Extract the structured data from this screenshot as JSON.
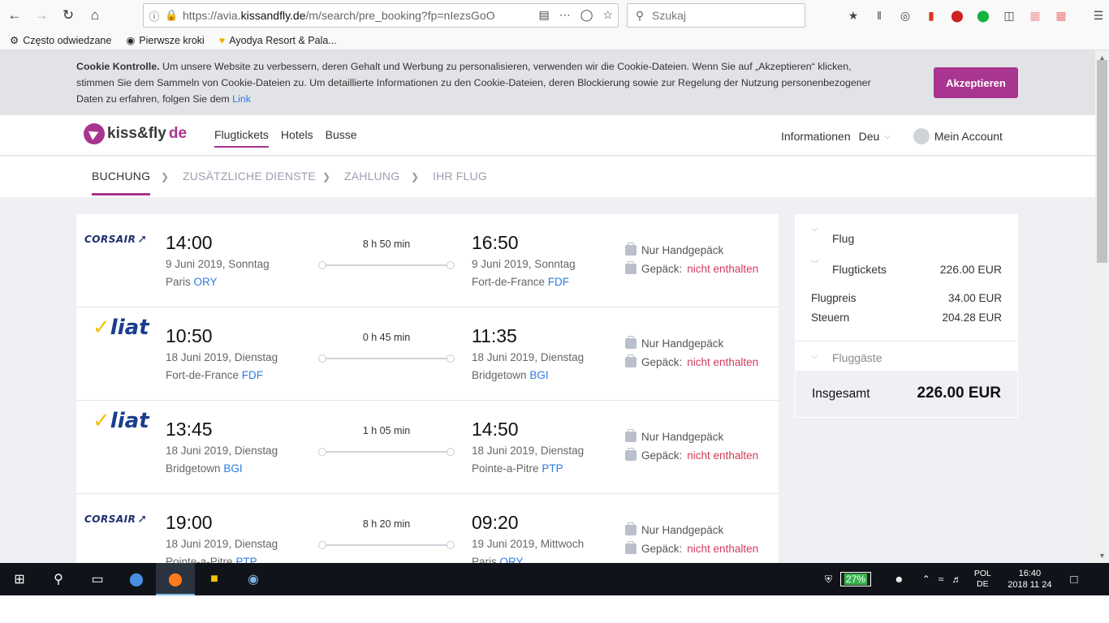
{
  "browser": {
    "url_prefix": "https://avia.",
    "url_domain": "kissandfly.de",
    "url_suffix": "/m/search/pre_booking?fp=nIezsGoO",
    "search_placeholder": "Szukaj",
    "bookmarks": [
      {
        "icon": "gear-icon",
        "label": "Często odwiedzane"
      },
      {
        "icon": "globe-icon",
        "label": "Pierwsze kroki"
      },
      {
        "icon": "heart-icon",
        "label": "Ayodya Resort & Pala..."
      }
    ]
  },
  "cookie": {
    "title": "Cookie Kontrolle.",
    "text": " Um unsere Website zu verbessern, deren Gehalt und Werbung zu personalisieren, verwenden wir die Cookie-Dateien. Wenn Sie auf „Akzeptieren“ klicken, stimmen Sie dem Sammeln von Cookie-Dateien zu. Um detaillierte Informationen zu den Cookie-Dateien, deren Blockierung sowie zur Regelung der Nutzung personenbezogener Daten zu erfahren, folgen Sie dem ",
    "link": "Link",
    "accept": "Akzeptieren"
  },
  "header": {
    "logo_main": "kiss&fly",
    "logo_accent": "de",
    "nav": [
      "Flugtickets",
      "Hotels",
      "Busse"
    ],
    "info": "Informationen",
    "lang": "Deu",
    "account": "Mein Account"
  },
  "steps": [
    "BUCHUNG",
    "ZUSÄTZLICHE DIENSTE",
    "ZAHLUNG",
    "IHR FLUG"
  ],
  "flights": [
    {
      "airline": "CORSAIR",
      "dep_time": "14:00",
      "dep_date": "9 Juni 2019, Sonntag",
      "dep_city": "Paris",
      "dep_code": "ORY",
      "duration": "8 h 50 min",
      "arr_time": "16:50",
      "arr_date": "9 Juni 2019, Sonntag",
      "arr_city": "Fort-de-France",
      "arr_code": "FDF",
      "bag1": "Nur Handgepäck",
      "bag2_label": "Gepäck:",
      "bag2_status": "nicht enthalten"
    },
    {
      "airline": "liat",
      "dep_time": "10:50",
      "dep_date": "18 Juni 2019, Dienstag",
      "dep_city": "Fort-de-France",
      "dep_code": "FDF",
      "duration": "0 h 45 min",
      "arr_time": "11:35",
      "arr_date": "18 Juni 2019, Dienstag",
      "arr_city": "Bridgetown",
      "arr_code": "BGI",
      "bag1": "Nur Handgepäck",
      "bag2_label": "Gepäck:",
      "bag2_status": "nicht enthalten"
    },
    {
      "airline": "liat",
      "dep_time": "13:45",
      "dep_date": "18 Juni 2019, Dienstag",
      "dep_city": "Bridgetown",
      "dep_code": "BGI",
      "duration": "1 h 05 min",
      "arr_time": "14:50",
      "arr_date": "18 Juni 2019, Dienstag",
      "arr_city": "Pointe-a-Pitre",
      "arr_code": "PTP",
      "bag1": "Nur Handgepäck",
      "bag2_label": "Gepäck:",
      "bag2_status": "nicht enthalten"
    },
    {
      "airline": "CORSAIR",
      "dep_time": "19:00",
      "dep_date": "18 Juni 2019, Dienstag",
      "dep_city": "Pointe-a-Pitre",
      "dep_code": "PTP",
      "duration": "8 h 20 min",
      "arr_time": "09:20",
      "arr_date": "19 Juni 2019, Mittwoch",
      "arr_city": "Paris",
      "arr_code": "ORY",
      "bag1": "Nur Handgepäck",
      "bag2_label": "Gepäck:",
      "bag2_status": "nicht enthalten"
    }
  ],
  "summary": {
    "flug": "Flug",
    "tickets_label": "Flugtickets",
    "tickets_value": "226.00 EUR",
    "price_label": "Flugpreis",
    "price_value": "34.00 EUR",
    "tax_label": "Steuern",
    "tax_value": "204.28 EUR",
    "passengers": "Fluggäste",
    "total_label": "Insgesamt",
    "total_value": "226.00 EUR"
  },
  "taskbar": {
    "battery": "27%",
    "lang_top": "POL",
    "lang_bottom": "DE",
    "time": "16:40",
    "date": "2018 11 24"
  },
  "colors": {
    "accent": "#a8358f",
    "link": "#2c7be5",
    "excluded": "#d23b5c"
  }
}
